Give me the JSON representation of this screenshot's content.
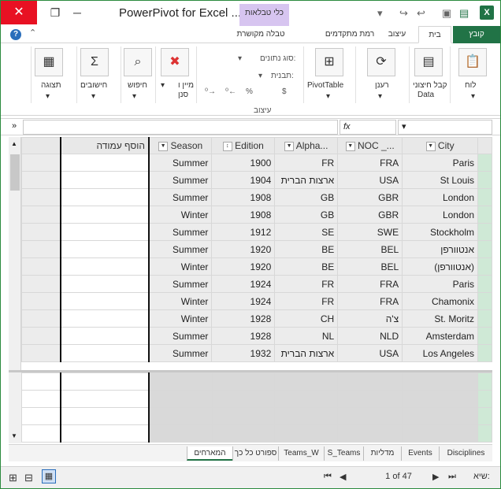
{
  "window": {
    "title": "PowerPivot for Excel ...",
    "context_tab": "כלי טבלאות",
    "close_glyph": "✕",
    "min_glyph": "─",
    "restore_glyph": "❐",
    "app_icon_label": "X"
  },
  "tabs": {
    "file": "קובץ",
    "home": "בית",
    "design": "עיצוב",
    "advanced": "רמת מתקדמים",
    "linked_table": "טבלה מקושרת"
  },
  "ribbon": {
    "paste": "לוח",
    "get_external": "קבל חיצוני",
    "get_external_sub": "Data",
    "refresh": "רענן",
    "pivot": "PivotTable",
    "data_type": "סוג נתונים:",
    "format": "תבנית:",
    "format_group": "עיצוב",
    "sort": "מיין ו",
    "sort_sub": "סנן",
    "find": "חיפוש",
    "calc": "חישובים",
    "view": "תצוגה",
    "currency": "$",
    "percent": "%"
  },
  "formula_bar": {
    "fx": "fx"
  },
  "grid": {
    "headers": {
      "city": "City",
      "noc": "NOC _...",
      "alpha": "Alpha...",
      "edition": "Edition",
      "season": "Season",
      "add_column": "הוסף עמודה"
    },
    "rows": [
      {
        "city": "Paris",
        "noc": "FRA",
        "alpha": "FR",
        "edition": "1900",
        "season": "Summer"
      },
      {
        "city": "St Louis",
        "noc": "USA",
        "alpha": "ארצות הברית",
        "edition": "1904",
        "season": "Summer"
      },
      {
        "city": "London",
        "noc": "GBR",
        "alpha": "GB",
        "edition": "1908",
        "season": "Summer"
      },
      {
        "city": "London",
        "noc": "GBR",
        "alpha": "GB",
        "edition": "1908",
        "season": "Winter"
      },
      {
        "city": "Stockholm",
        "noc": "SWE",
        "alpha": "SE",
        "edition": "1912",
        "season": "Summer"
      },
      {
        "city": "אנטוורפן",
        "noc": "BEL",
        "alpha": "BE",
        "edition": "1920",
        "season": "Summer"
      },
      {
        "city": "(אנטוורפן)",
        "noc": "BEL",
        "alpha": "BE",
        "edition": "1920",
        "season": "Winter"
      },
      {
        "city": "Paris",
        "noc": "FRA",
        "alpha": "FR",
        "edition": "1924",
        "season": "Summer"
      },
      {
        "city": "Chamonix",
        "noc": "FRA",
        "alpha": "FR",
        "edition": "1924",
        "season": "Winter"
      },
      {
        "city": "St. Moritz",
        "noc": "צ'ה",
        "alpha": "CH",
        "edition": "1928",
        "season": "Winter"
      },
      {
        "city": "Amsterdam",
        "noc": "NLD",
        "alpha": "NL",
        "edition": "1928",
        "season": "Summer"
      },
      {
        "city": "Los Angeles",
        "noc": "USA",
        "alpha": "ארצות הברית",
        "edition": "1932",
        "season": "Summer"
      }
    ]
  },
  "sheet_tabs": [
    {
      "label": "Disciplines",
      "active": false
    },
    {
      "label": "Events",
      "active": false
    },
    {
      "label": "מדליות",
      "active": false
    },
    {
      "label": "S_Teams",
      "active": false
    },
    {
      "label": "Teams_W",
      "active": false
    },
    {
      "label": "ספורט כל כך",
      "active": false
    },
    {
      "label": "המארחים",
      "active": true
    }
  ],
  "status": {
    "record_label": "שיא:",
    "record_value": "1 of 47"
  }
}
